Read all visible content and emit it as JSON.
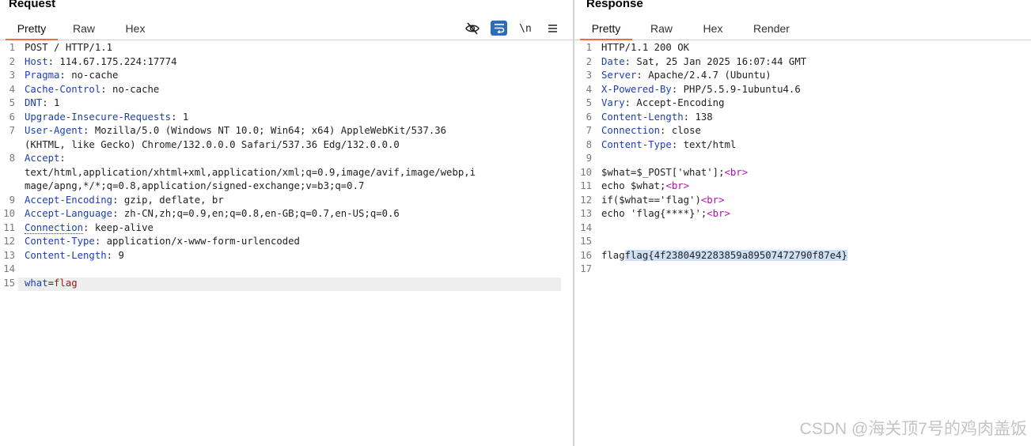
{
  "request": {
    "title": "Request",
    "tabs": [
      "Pretty",
      "Raw",
      "Hex"
    ],
    "active_tab": "Pretty",
    "toolbar": {
      "newline_label": "\\n",
      "icons": [
        "eye-off-icon",
        "wrap-icon",
        "newline-icon",
        "menu-icon"
      ]
    },
    "lines": [
      {
        "n": "1",
        "text": "POST / HTTP/1.1"
      },
      {
        "n": "2",
        "key": "Host",
        "val": " 114.67.175.224:17774"
      },
      {
        "n": "3",
        "key": "Pragma",
        "val": " no-cache"
      },
      {
        "n": "4",
        "key": "Cache-Control",
        "val": " no-cache"
      },
      {
        "n": "5",
        "key": "DNT",
        "val": " 1"
      },
      {
        "n": "6",
        "key": "Upgrade-Insecure-Requests",
        "val": " 1"
      },
      {
        "n": "7",
        "key": "User-Agent",
        "val": " Mozilla/5.0 (Windows NT 10.0; Win64; x64) AppleWebKit/537.36"
      },
      {
        "n": "",
        "text": "(KHTML, like Gecko) Chrome/132.0.0.0 Safari/537.36 Edg/132.0.0.0"
      },
      {
        "n": "8",
        "key": "Accept",
        "val": ""
      },
      {
        "n": "",
        "text": "text/html,application/xhtml+xml,application/xml;q=0.9,image/avif,image/webp,i"
      },
      {
        "n": "",
        "text": "mage/apng,*/*;q=0.8,application/signed-exchange;v=b3;q=0.7"
      },
      {
        "n": "9",
        "key": "Accept-Encoding",
        "val": " gzip, deflate, br"
      },
      {
        "n": "10",
        "key": "Accept-Language",
        "val": " zh-CN,zh;q=0.9,en;q=0.8,en-GB;q=0.7,en-US;q=0.6"
      },
      {
        "n": "11",
        "key": "Connection",
        "val": " keep-alive",
        "dotted": true
      },
      {
        "n": "12",
        "key": "Content-Type",
        "val": " application/x-www-form-urlencoded"
      },
      {
        "n": "13",
        "key": "Content-Length",
        "val": " 9"
      },
      {
        "n": "14",
        "text": ""
      },
      {
        "n": "15",
        "body_key": "what",
        "body_eq": "=",
        "body_val": "flag"
      }
    ]
  },
  "response": {
    "title": "Response",
    "tabs": [
      "Pretty",
      "Raw",
      "Hex",
      "Render"
    ],
    "active_tab": "Pretty",
    "lines": [
      {
        "n": "1",
        "text": "HTTP/1.1 200 OK"
      },
      {
        "n": "2",
        "key": "Date",
        "val": " Sat, 25 Jan 2025 16:07:44 GMT"
      },
      {
        "n": "3",
        "key": "Server",
        "val": " Apache/2.4.7 (Ubuntu)"
      },
      {
        "n": "4",
        "key": "X-Powered-By",
        "val": " PHP/5.5.9-1ubuntu4.6"
      },
      {
        "n": "5",
        "key": "Vary",
        "val": " Accept-Encoding"
      },
      {
        "n": "6",
        "key": "Content-Length",
        "val": " 138"
      },
      {
        "n": "7",
        "key": "Connection",
        "val": " close"
      },
      {
        "n": "8",
        "key": "Content-Type",
        "val": " text/html"
      },
      {
        "n": "9",
        "text": ""
      },
      {
        "n": "10",
        "pre": "$what=$_POST['what'];",
        "tag": "<br>"
      },
      {
        "n": "11",
        "pre": "echo $what;",
        "tag": "<br>"
      },
      {
        "n": "12",
        "pre": "if($what=='flag')",
        "tag": "<br>"
      },
      {
        "n": "13",
        "pre": "echo 'flag{****}';",
        "tag": "<br>"
      },
      {
        "n": "14",
        "text": ""
      },
      {
        "n": "15",
        "text": ""
      },
      {
        "n": "16",
        "pre": "flag",
        "selected": "flag{4f2380492283859a89507472790f87e4}"
      },
      {
        "n": "17",
        "text": ""
      }
    ]
  },
  "watermark": "CSDN @海关顶7号的鸡肉盖饭"
}
